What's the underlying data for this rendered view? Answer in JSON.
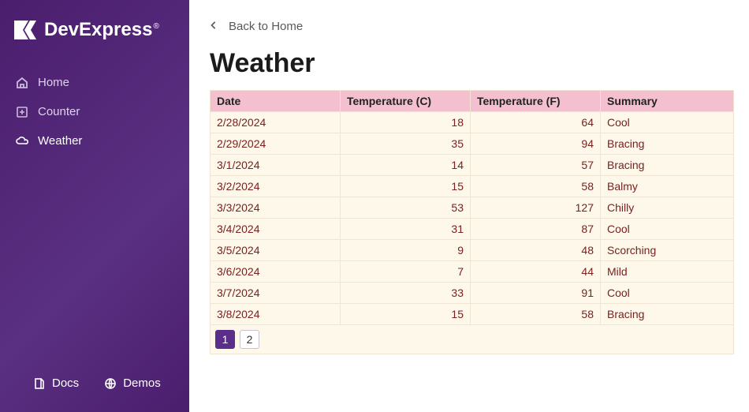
{
  "brand": {
    "name": "DevExpress",
    "reg": "®"
  },
  "sidebar": {
    "items": [
      {
        "label": "Home",
        "icon": "home-icon"
      },
      {
        "label": "Counter",
        "icon": "counter-icon"
      },
      {
        "label": "Weather",
        "icon": "weather-icon"
      }
    ],
    "bottom": [
      {
        "label": "Docs",
        "icon": "docs-icon"
      },
      {
        "label": "Demos",
        "icon": "demos-icon"
      }
    ]
  },
  "back_label": "Back to Home",
  "title": "Weather",
  "columns": [
    "Date",
    "Temperature (C)",
    "Temperature (F)",
    "Summary"
  ],
  "rows": [
    {
      "date": "2/28/2024",
      "c": 18,
      "f": 64,
      "s": "Cool"
    },
    {
      "date": "2/29/2024",
      "c": 35,
      "f": 94,
      "s": "Bracing"
    },
    {
      "date": "3/1/2024",
      "c": 14,
      "f": 57,
      "s": "Bracing"
    },
    {
      "date": "3/2/2024",
      "c": 15,
      "f": 58,
      "s": "Balmy"
    },
    {
      "date": "3/3/2024",
      "c": 53,
      "f": 127,
      "s": "Chilly"
    },
    {
      "date": "3/4/2024",
      "c": 31,
      "f": 87,
      "s": "Cool"
    },
    {
      "date": "3/5/2024",
      "c": 9,
      "f": 48,
      "s": "Scorching"
    },
    {
      "date": "3/6/2024",
      "c": 7,
      "f": 44,
      "s": "Mild"
    },
    {
      "date": "3/7/2024",
      "c": 33,
      "f": 91,
      "s": "Cool"
    },
    {
      "date": "3/8/2024",
      "c": 15,
      "f": 58,
      "s": "Bracing"
    }
  ],
  "pages": [
    {
      "n": "1",
      "active": true
    },
    {
      "n": "2",
      "active": false
    }
  ]
}
